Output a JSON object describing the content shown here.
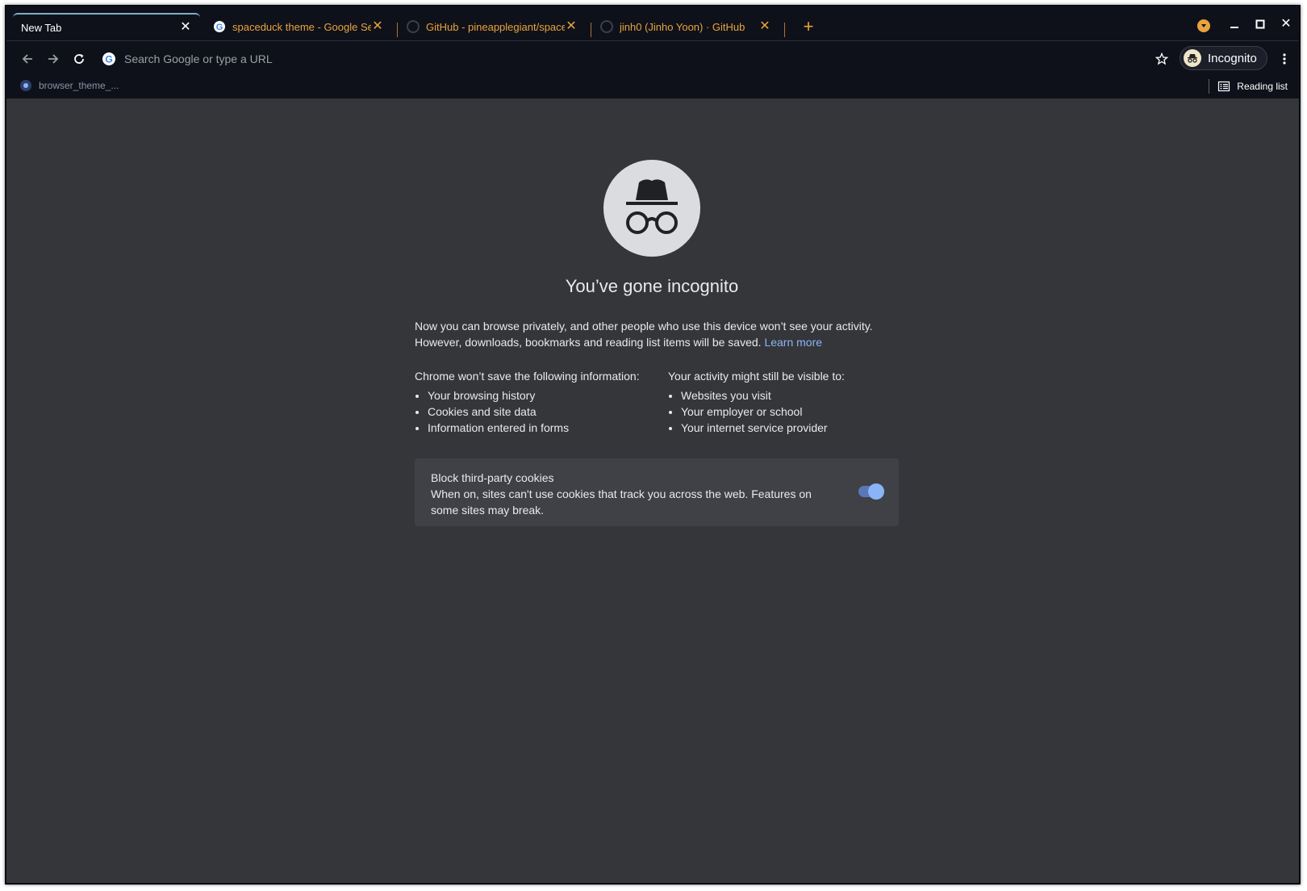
{
  "tabs": [
    {
      "label": "New Tab",
      "active": true,
      "icon": "incognito-icon"
    },
    {
      "label": "spaceduck theme - Google Search",
      "active": false,
      "icon": "google-icon"
    },
    {
      "label": "GitHub - pineapplegiant/spaceduck",
      "active": false,
      "icon": "github-icon"
    },
    {
      "label": "jinh0 (Jinho Yoon) · GitHub",
      "active": false,
      "icon": "github-icon"
    }
  ],
  "toolbar": {
    "omnibox_placeholder": "Search Google or type a URL",
    "profile_label": "Incognito"
  },
  "bookmarks": {
    "item_label": "browser_theme_...",
    "reading_list_label": "Reading list"
  },
  "page": {
    "title": "You’ve gone incognito",
    "intro": "Now you can browse privately, and other people who use this device won’t see your activity. However, downloads, bookmarks and reading list items will be saved.",
    "learn_more": "Learn more",
    "left_head_pre": "Chrome ",
    "left_head_bold": "won’t save",
    "left_head_post": " the following information:",
    "left_items": [
      "Your browsing history",
      "Cookies and site data",
      "Information entered in forms"
    ],
    "right_head_pre": "Your activity ",
    "right_head_bold": "might still be visible",
    "right_head_post": " to:",
    "right_items": [
      "Websites you visit",
      "Your employer or school",
      "Your internet service provider"
    ],
    "cookie_title": "Block third-party cookies",
    "cookie_desc": "When on, sites can't use cookies that track you across the web. Features on some sites may break."
  },
  "colors": {
    "accent": "#e8a33d",
    "link": "#8ab4f8",
    "chrome_bg": "#0f111a",
    "page_bg": "#35363a"
  }
}
